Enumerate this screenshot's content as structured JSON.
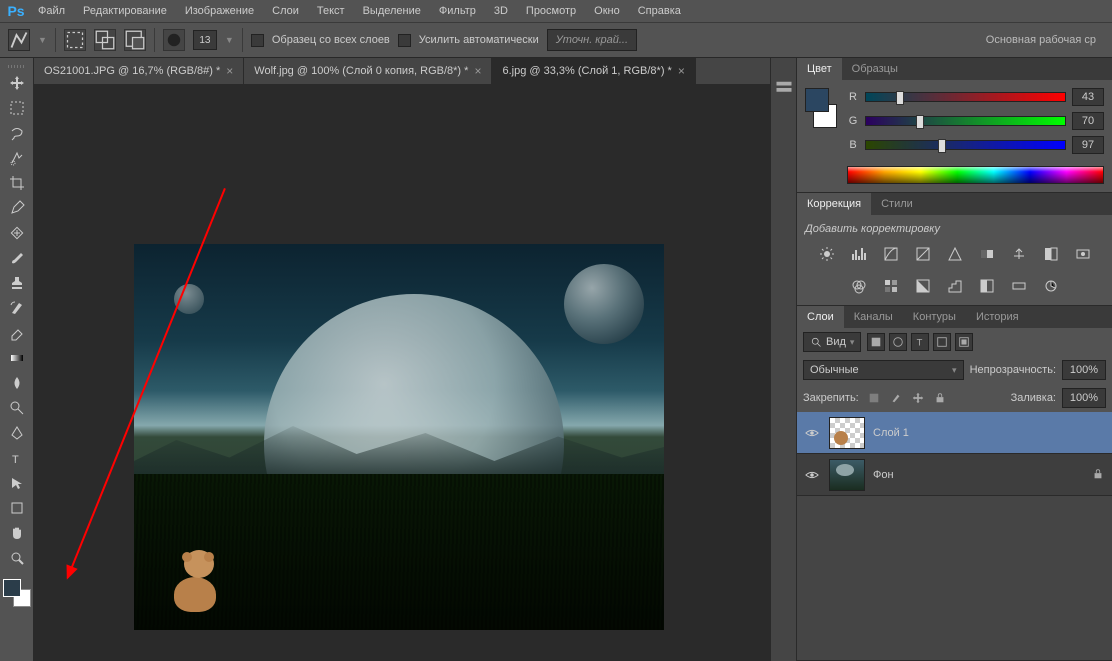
{
  "menubar": {
    "items": [
      "Файл",
      "Редактирование",
      "Изображение",
      "Слои",
      "Текст",
      "Выделение",
      "Фильтр",
      "3D",
      "Просмотр",
      "Окно",
      "Справка"
    ]
  },
  "options": {
    "brush_size": "13",
    "sample_all_label": "Образец со всех слоев",
    "auto_enhance_label": "Усилить автоматически",
    "refine_placeholder": "Уточн. край...",
    "right_status": "Основная рабочая ср"
  },
  "tabs": [
    {
      "label": "OS21001.JPG @ 16,7% (RGB/8#) *",
      "active": false
    },
    {
      "label": "Wolf.jpg @ 100% (Слой 0 копия, RGB/8*) *",
      "active": false
    },
    {
      "label": "6.jpg @ 33,3% (Слой 1, RGB/8*) *",
      "active": true
    }
  ],
  "colors": {
    "fg": "#2b4661",
    "bg": "#ffffff"
  },
  "color_panel": {
    "tabs": [
      "Цвет",
      "Образцы"
    ],
    "channels": [
      {
        "label": "R",
        "value": "43",
        "pct": 17
      },
      {
        "label": "G",
        "value": "70",
        "pct": 27
      },
      {
        "label": "B",
        "value": "97",
        "pct": 38
      }
    ]
  },
  "adjustments_panel": {
    "tabs": [
      "Коррекция",
      "Стили"
    ],
    "title": "Добавить корректировку"
  },
  "layers_panel": {
    "tabs": [
      "Слои",
      "Каналы",
      "Контуры",
      "История"
    ],
    "search_kind": "Вид",
    "blend_mode": "Обычные",
    "opacity_label": "Непрозрачность:",
    "opacity_value": "100%",
    "lock_label": "Закрепить:",
    "fill_label": "Заливка:",
    "fill_value": "100%",
    "layers": [
      {
        "name": "Слой 1",
        "active": true,
        "thumb": "checker",
        "locked": false
      },
      {
        "name": "Фон",
        "active": false,
        "thumb": "landscape",
        "locked": true
      }
    ]
  }
}
